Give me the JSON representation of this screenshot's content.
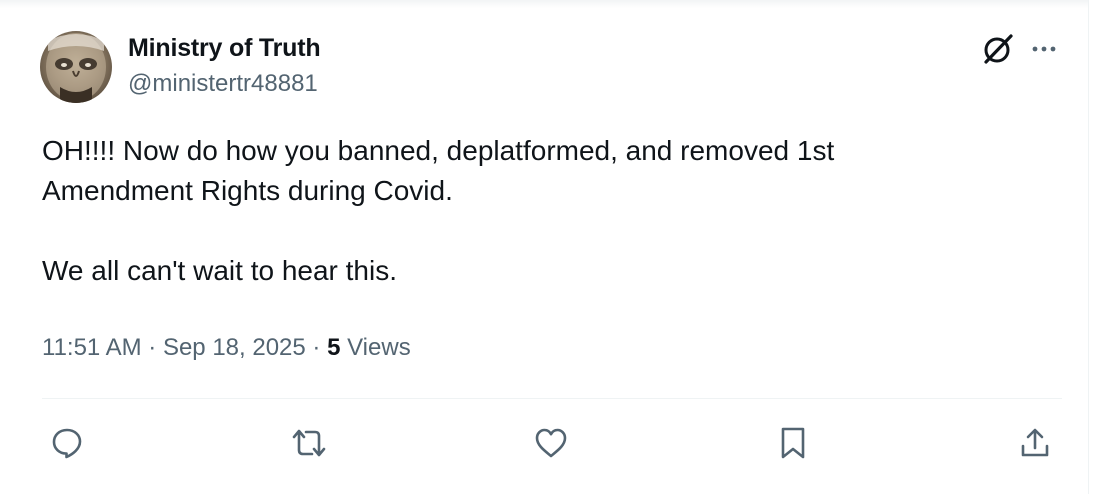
{
  "tweet": {
    "author": {
      "display_name": "Ministry of Truth",
      "handle": "@ministertr48881"
    },
    "text": "OH!!!! Now do how you banned, deplatformed, and removed 1st\nAmendment Rights during Covid.\n\nWe all can't wait to hear this.",
    "time": "11:51 AM",
    "separator": " · ",
    "date": "Sep 18, 2025",
    "views_count": "5",
    "views_label": "Views"
  },
  "header_icons": [
    "grok-icon",
    "more-options-icon"
  ],
  "actions": [
    "reply-icon",
    "retweet-icon",
    "like-icon",
    "bookmark-icon",
    "share-icon"
  ],
  "colors": {
    "text": "#0f1419",
    "secondary": "#536471",
    "divider": "#eff3f4"
  }
}
